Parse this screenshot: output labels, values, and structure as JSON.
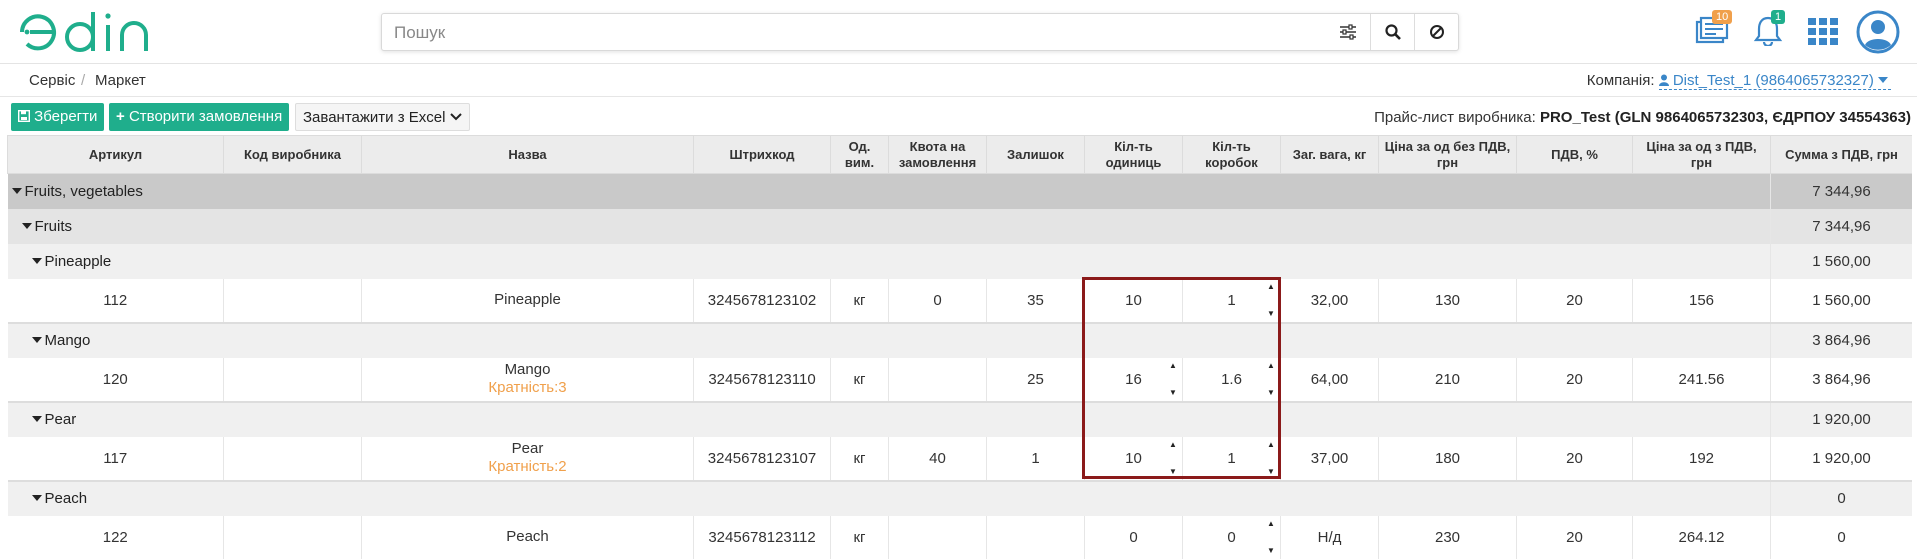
{
  "header": {
    "logo_text": "edin",
    "search_placeholder": "Пошук",
    "icons": [
      "filter-icon",
      "search-icon",
      "clear-icon",
      "documents-icon",
      "bell-icon",
      "apps-grid-icon",
      "user-avatar-icon"
    ],
    "badges": {
      "documents": "10",
      "notifications": "1"
    },
    "colors": {
      "brand": "#1fae8c",
      "badge_orange": "#f0a04b",
      "badge_green": "#1fae8c",
      "avatar": "#3a86c8",
      "highlight": "#8b1a1a"
    }
  },
  "breadcrumb": {
    "item1": "Сервіс",
    "separator": "/",
    "item2": "Маркет"
  },
  "company": {
    "label": "Компанія:",
    "value": "Dist_Test_1 (9864065732327)"
  },
  "toolbar": {
    "save": "Зберегти",
    "create_order": "Створити замовлення",
    "excel": "Завантажити з Excel",
    "pricelist_label": "Прайс-лист виробника:",
    "pricelist_value": "PRO_Test (GLN 9864065732303, ЄДРПОУ 34554363)"
  },
  "table": {
    "columns": [
      "Артикул",
      "Код виробника",
      "Назва",
      "Штрихкод",
      "Од. вим.",
      "Квота на замовлення",
      "Залишок",
      "Кіл-ть одиниць",
      "Кіл-ть коробок",
      "Заг. вага, кг",
      "Ціна за од без ПДВ, грн",
      "ПДВ, %",
      "Ціна за од з ПДВ, грн",
      "Сумма з ПДВ, грн"
    ],
    "group_root": {
      "name": "Fruits, vegetables",
      "total": "7 344,96"
    },
    "group_sub": {
      "name": "Fruits",
      "total": "7 344,96"
    },
    "items": [
      {
        "group": "Pineapple",
        "group_total": "1 560,00",
        "article": "112",
        "maker_code": "",
        "name": "Pineapple",
        "multiplicity": "",
        "barcode": "3245678123102",
        "unit": "кг",
        "quota": "0",
        "stock": "35",
        "qty_units": "10",
        "qty_boxes": "1",
        "weight": "32,00",
        "price_no_vat": "130",
        "vat": "20",
        "price_vat": "156",
        "sum_vat": "1 560,00"
      },
      {
        "group": "Mango",
        "group_total": "3 864,96",
        "article": "120",
        "maker_code": "",
        "name": "Mango",
        "multiplicity": "Кратність:3",
        "barcode": "3245678123110",
        "unit": "кг",
        "quota": "",
        "stock": "25",
        "qty_units": "16",
        "qty_boxes": "1.6",
        "weight": "64,00",
        "price_no_vat": "210",
        "vat": "20",
        "price_vat": "241.56",
        "sum_vat": "3 864,96"
      },
      {
        "group": "Pear",
        "group_total": "1 920,00",
        "article": "117",
        "maker_code": "",
        "name": "Pear",
        "multiplicity": "Кратність:2",
        "barcode": "3245678123107",
        "unit": "кг",
        "quota": "40",
        "stock": "1",
        "qty_units": "10",
        "qty_boxes": "1",
        "weight": "37,00",
        "price_no_vat": "180",
        "vat": "20",
        "price_vat": "192",
        "sum_vat": "1 920,00"
      },
      {
        "group": "Peach",
        "group_total": "0",
        "article": "122",
        "maker_code": "",
        "name": "Peach",
        "multiplicity": "",
        "barcode": "3245678123112",
        "unit": "кг",
        "quota": "",
        "stock": "",
        "qty_units": "0",
        "qty_boxes": "0",
        "weight": "Н/д",
        "price_no_vat": "230",
        "vat": "20",
        "price_vat": "264.12",
        "sum_vat": "0"
      }
    ]
  }
}
